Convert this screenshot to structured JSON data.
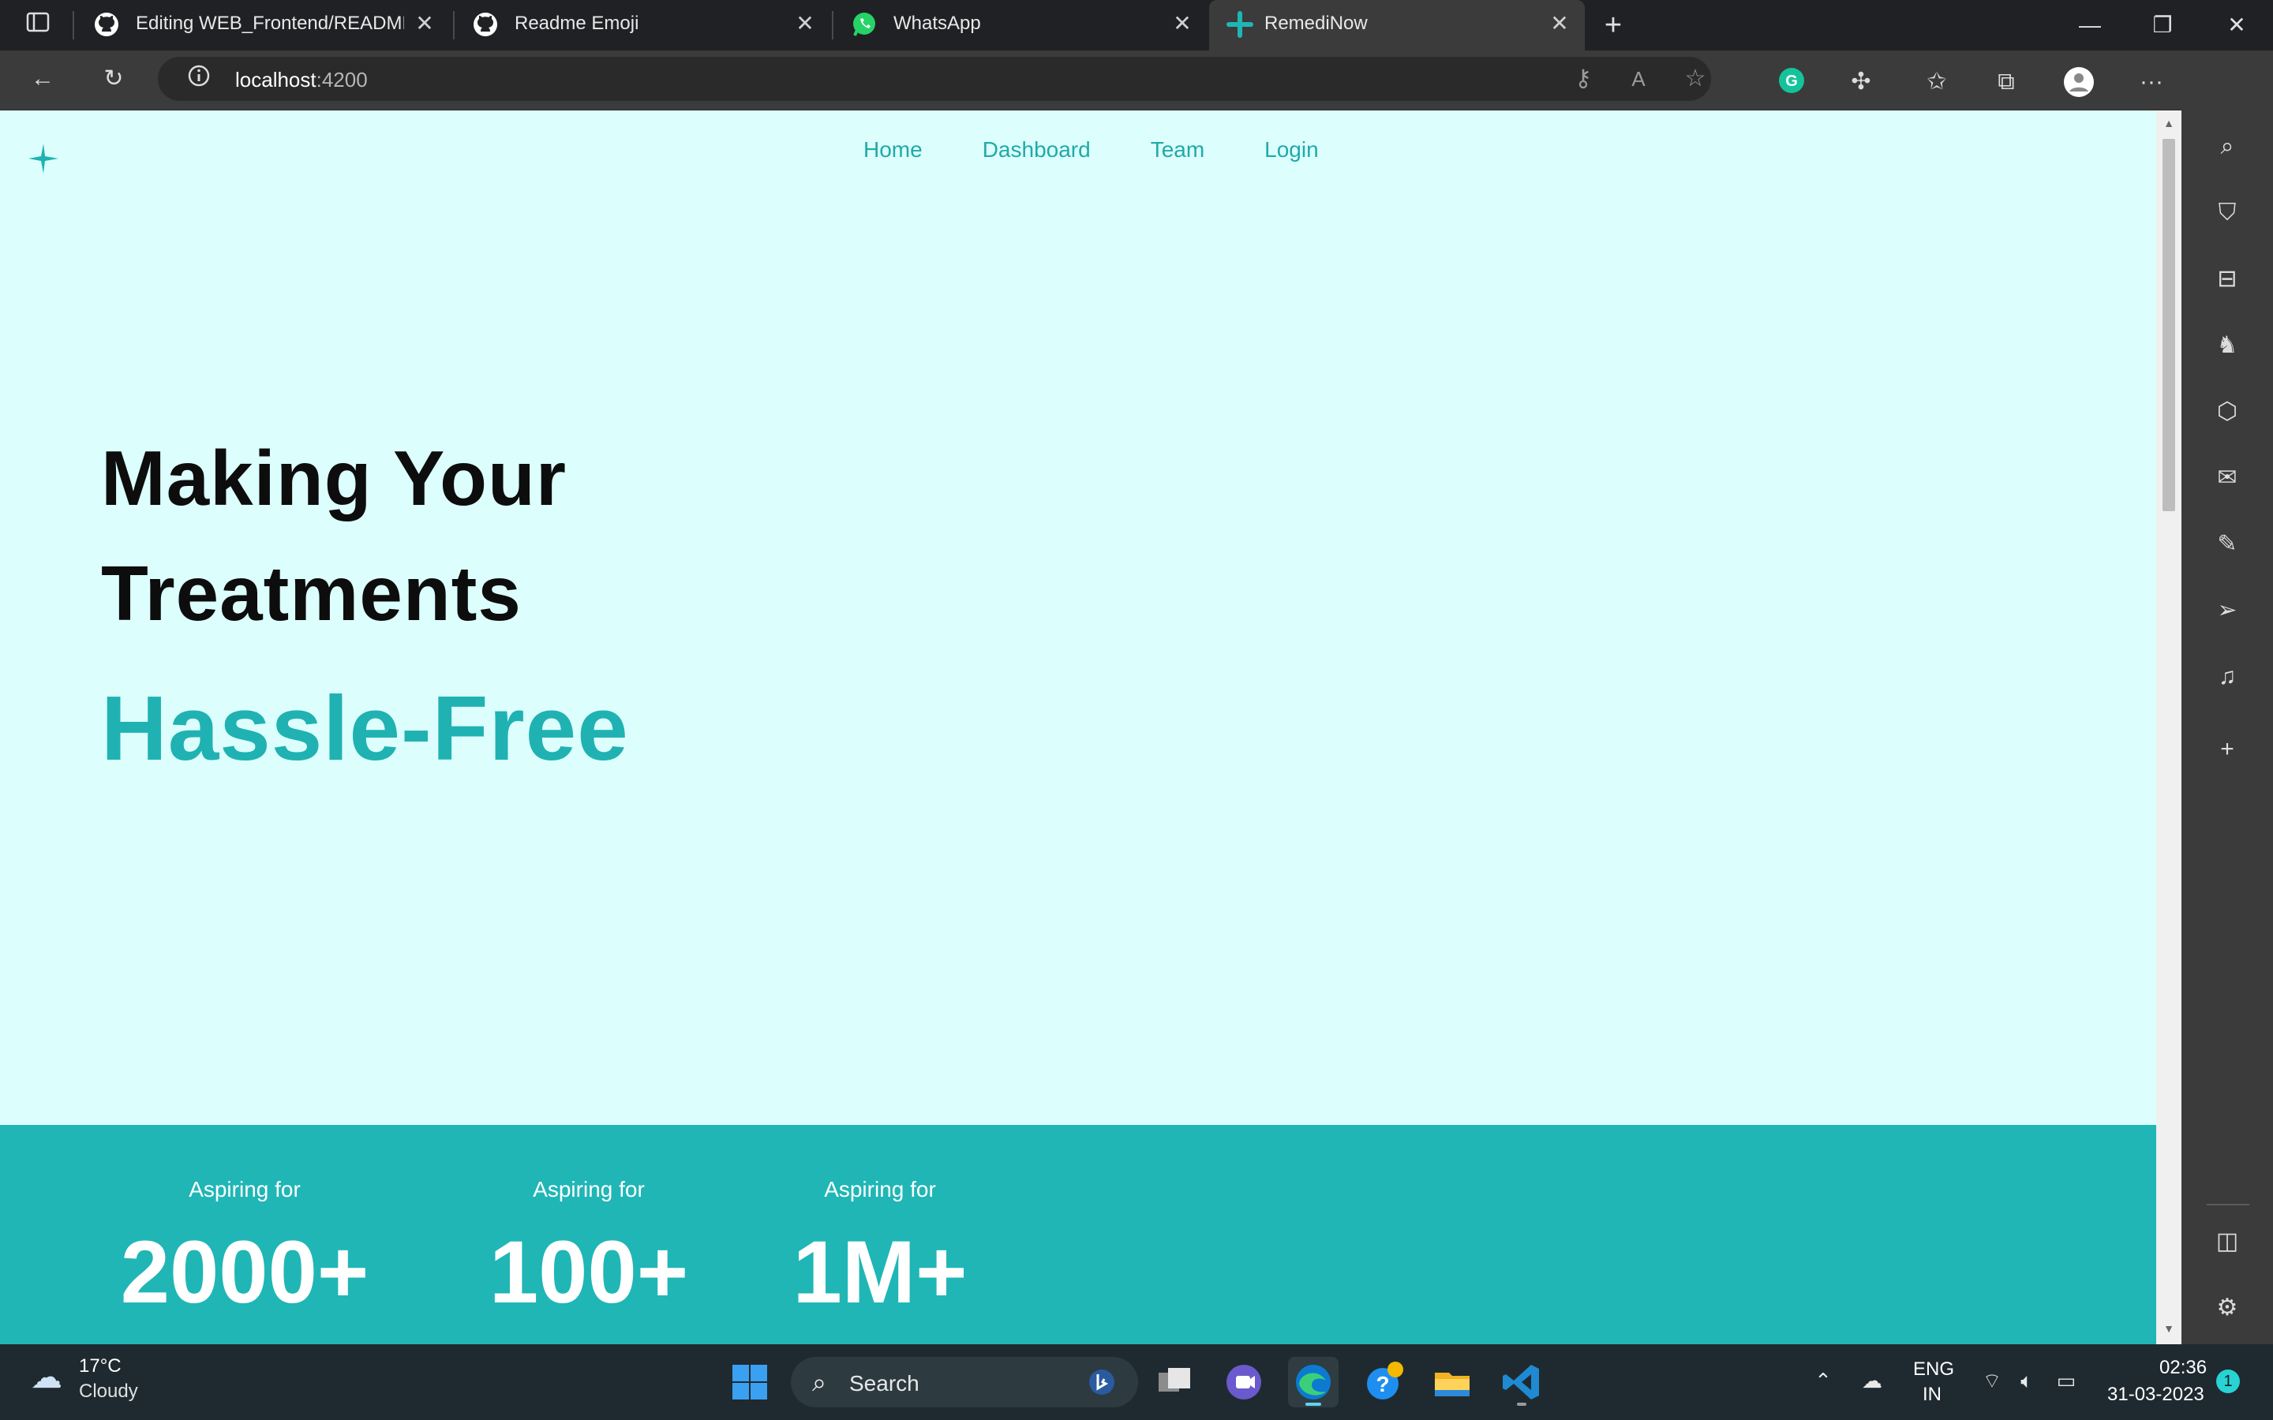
{
  "browser": {
    "tabs": [
      {
        "title": "Editing WEB_Frontend/README.md",
        "icon": "github-icon"
      },
      {
        "title": "Readme Emoji",
        "icon": "github-icon"
      },
      {
        "title": "WhatsApp",
        "icon": "whatsapp-icon"
      },
      {
        "title": "RemediNow",
        "icon": "remedinow-icon",
        "active": true
      }
    ],
    "address": {
      "host": "localhost",
      "port": ":4200"
    }
  },
  "site": {
    "nav": [
      "Home",
      "Dashboard",
      "Team",
      "Login"
    ],
    "hero": {
      "line1": "Making Your",
      "line2": "Treatments",
      "line3": "Hassle-Free"
    },
    "stats": [
      {
        "label": "Aspiring for",
        "value": "2000+"
      },
      {
        "label": "Aspiring for",
        "value": "100+"
      },
      {
        "label": "Aspiring for",
        "value": "1M+"
      }
    ],
    "colors": {
      "background": "#dcfffe",
      "accent": "#20b6b6",
      "heading": "#0d0d0d"
    }
  },
  "taskbar": {
    "weather": {
      "temp": "17°C",
      "condition": "Cloudy"
    },
    "search_label": "Search",
    "lang": {
      "line1": "ENG",
      "line2": "IN"
    },
    "time": "02:36",
    "date": "31-03-2023",
    "notifications": "1"
  }
}
